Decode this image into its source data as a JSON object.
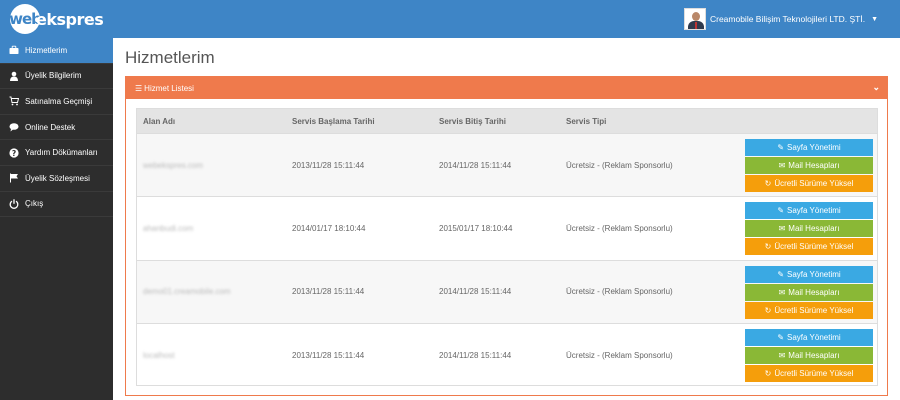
{
  "brand": {
    "logo_web": "web",
    "logo_rest": "ekspres"
  },
  "user": {
    "company": "Creamobile Bilişim Teknolojileri LTD. ŞTİ."
  },
  "sidebar": {
    "items": [
      {
        "label": "Hizmetlerim",
        "icon": "briefcase-icon"
      },
      {
        "label": "Üyelik Bilgilerim",
        "icon": "user-icon"
      },
      {
        "label": "Satınalma Geçmişi",
        "icon": "cart-icon"
      },
      {
        "label": "Online Destek",
        "icon": "chat-icon"
      },
      {
        "label": "Yardım Dökümanları",
        "icon": "question-icon"
      },
      {
        "label": "Üyelik Sözleşmesi",
        "icon": "flag-icon"
      },
      {
        "label": "Çıkış",
        "icon": "power-icon"
      }
    ]
  },
  "page": {
    "title": "Hizmetlerim"
  },
  "panel": {
    "title": "Hizmet Listesi"
  },
  "table": {
    "headers": [
      "Alan Adı",
      "Servis Başlama Tarihi",
      "Servis Bitiş Tarihi",
      "Servis Tipi"
    ],
    "rows": [
      {
        "domain": "webekspres.com",
        "start": "2013/11/28 15:11:44",
        "end": "2014/11/28 15:11:44",
        "type": "Ücretsiz - (Reklam Sponsorlu)"
      },
      {
        "domain": "ahanbudi.com",
        "start": "2014/01/17 18:10:44",
        "end": "2015/01/17 18:10:44",
        "type": "Ücretsiz - (Reklam Sponsorlu)"
      },
      {
        "domain": "demo01.creamobile.com",
        "start": "2013/11/28 15:11:44",
        "end": "2014/11/28 15:11:44",
        "type": "Ücretsiz - (Reklam Sponsorlu)"
      },
      {
        "domain": "localhost",
        "start": "2013/11/28 15:11:44",
        "end": "2014/11/28 15:11:44",
        "type": "Ücretsiz - (Reklam Sponsorlu)"
      }
    ],
    "actions": {
      "page": "Sayfa Yönetimi",
      "mail": "Mail Hesapları",
      "upgrade": "Ücretli Sürüme Yüksel"
    }
  },
  "colors": {
    "topbar": "#3e85c6",
    "sidebar": "#2d2d2d",
    "panel_accent": "#ef7a4c",
    "btn_blue": "#3aa9e3",
    "btn_green": "#8ab836",
    "btn_orange": "#f59e0b"
  }
}
